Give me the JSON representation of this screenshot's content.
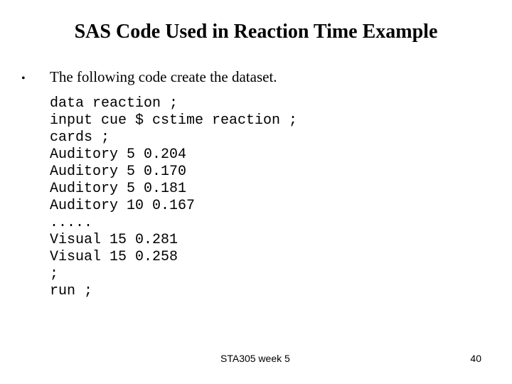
{
  "slide": {
    "title": "SAS Code Used in Reaction Time Example",
    "bullet_icon": "•",
    "bullet_text": "The following code create the dataset.",
    "code_lines": [
      "data reaction ;",
      "input cue $ cstime reaction ;",
      "cards ;",
      "Auditory 5 0.204",
      "Auditory 5 0.170",
      "Auditory 5 0.181",
      "Auditory 10 0.167",
      ".....",
      "Visual 15 0.281",
      "Visual 15 0.258",
      ";",
      "run ;"
    ]
  },
  "footer": {
    "course": "STA305 week 5",
    "page_number": "40"
  }
}
